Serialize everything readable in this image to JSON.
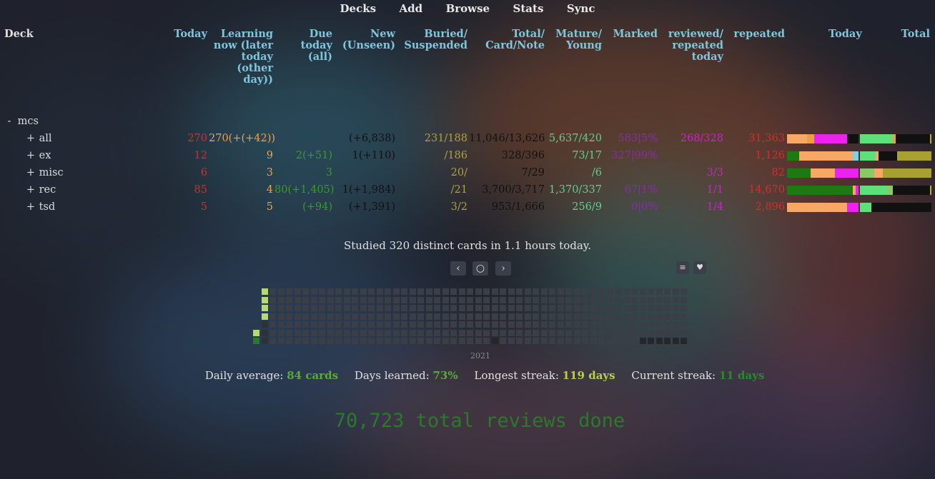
{
  "nav": [
    "Decks",
    "Add",
    "Browse",
    "Stats",
    "Sync"
  ],
  "columns": [
    {
      "key": "deck",
      "label": "Deck"
    },
    {
      "key": "today",
      "label": "Today"
    },
    {
      "key": "learning",
      "label": "Learning now (later today (other day))"
    },
    {
      "key": "due",
      "label": "Due today (all)"
    },
    {
      "key": "new",
      "label": "New (Unseen)"
    },
    {
      "key": "buried",
      "label": "Buried/ Suspended"
    },
    {
      "key": "total",
      "label": "Total/ Card/Note"
    },
    {
      "key": "mature",
      "label": "Mature/ Young"
    },
    {
      "key": "marked",
      "label": "Marked"
    },
    {
      "key": "reviewed",
      "label": "reviewed/ repeated today"
    },
    {
      "key": "repeated",
      "label": "repeated"
    },
    {
      "key": "bartoday",
      "label": "Today"
    },
    {
      "key": "bartotal",
      "label": "Total"
    }
  ],
  "decks": [
    {
      "name": "mcs",
      "expander": "-",
      "level": 0,
      "today": "",
      "learning": "",
      "due": "",
      "new": "",
      "buried": "",
      "total": "",
      "mature": "",
      "marked": "",
      "reviewed": "",
      "repeated": "",
      "bartoday": [],
      "bartotal": []
    },
    {
      "name": "all",
      "expander": "+",
      "level": 1,
      "today": "270",
      "learning": "270(+(+42))",
      "due": "",
      "new": "(+6,838)",
      "buried": "231/188",
      "total": "11,046/13,626",
      "mature": "5,637/420",
      "marked": "583|5%",
      "reviewed": "268/328",
      "repeated": "31,363",
      "bartoday": [
        {
          "c": "#f7a866",
          "w": 28
        },
        {
          "c": "#e8a040",
          "w": 10
        },
        {
          "c": "#ee22ee",
          "w": 46
        },
        {
          "c": "#111",
          "w": 16
        }
      ],
      "bartotal": [
        {
          "c": "#5de07a",
          "w": 46
        },
        {
          "c": "#e8a040",
          "w": 4
        },
        {
          "c": "#111",
          "w": 48
        },
        {
          "c": "#b8b030",
          "w": 2
        }
      ]
    },
    {
      "name": "ex",
      "expander": "+",
      "level": 1,
      "today": "12",
      "learning": "9",
      "due": "2(+51)",
      "new": "1(+110)",
      "buried": "/186",
      "total": "328/396",
      "mature": "73/17",
      "marked": "327|99%",
      "reviewed": "",
      "repeated": "1,126",
      "bartoday": [
        {
          "c": "#1d7a12",
          "w": 17
        },
        {
          "c": "#f7a866",
          "w": 75
        },
        {
          "c": "#7fd0e0",
          "w": 8
        }
      ],
      "bartotal": [
        {
          "c": "#5de07a",
          "w": 22
        },
        {
          "c": "#f7a866",
          "w": 4
        },
        {
          "c": "#111",
          "w": 26
        },
        {
          "c": "#a8a030",
          "w": 48
        }
      ]
    },
    {
      "name": "misc",
      "expander": "+",
      "level": 1,
      "today": "6",
      "learning": "3",
      "due": "3",
      "new": "",
      "buried": "20/",
      "total": "7/29",
      "mature": "/6",
      "marked": "",
      "reviewed": "3/3",
      "repeated": "82",
      "bartoday": [
        {
          "c": "#1d7a12",
          "w": 33
        },
        {
          "c": "#f7a866",
          "w": 34
        },
        {
          "c": "#ee22ee",
          "w": 33
        }
      ],
      "bartotal": [
        {
          "c": "#8ac86a",
          "w": 20
        },
        {
          "c": "#f7a866",
          "w": 12
        },
        {
          "c": "#a8a030",
          "w": 68
        }
      ]
    },
    {
      "name": "rec",
      "expander": "+",
      "level": 1,
      "today": "85",
      "learning": "4",
      "due": "80(+1,405)",
      "new": "1(+1,984)",
      "buried": "/21",
      "total": "3,700/3,717",
      "mature": "1,370/337",
      "marked": "67|1%",
      "reviewed": "1/1",
      "repeated": "14,670",
      "bartoday": [
        {
          "c": "#1d7a12",
          "w": 92
        },
        {
          "c": "#f7a866",
          "w": 4
        },
        {
          "c": "#ee22ee",
          "w": 4
        }
      ],
      "bartotal": [
        {
          "c": "#5de07a",
          "w": 38
        },
        {
          "c": "#8ac86a",
          "w": 8
        },
        {
          "c": "#111",
          "w": 52
        },
        {
          "c": "#b8b030",
          "w": 2
        }
      ]
    },
    {
      "name": "tsd",
      "expander": "+",
      "level": 1,
      "today": "5",
      "learning": "5",
      "due": "(+94)",
      "new": "(+1,391)",
      "buried": "3/2",
      "total": "953/1,666",
      "mature": "256/9",
      "marked": "0|0%",
      "reviewed": "1/4",
      "repeated": "2,896",
      "bartoday": [
        {
          "c": "#f7a866",
          "w": 84
        },
        {
          "c": "#ee22ee",
          "w": 16
        }
      ],
      "bartotal": [
        {
          "c": "#5de07a",
          "w": 16
        },
        {
          "c": "#111",
          "w": 84
        }
      ]
    }
  ],
  "studied": "Studied 320 distinct cards in 1.1 hours today.",
  "heatmap_year": "2021",
  "stats": {
    "daily_avg_label": "Daily average:",
    "daily_avg": "84 cards",
    "days_learned_label": "Days learned:",
    "days_learned": "73%",
    "longest_label": "Longest streak:",
    "longest": "119 days",
    "current_label": "Current streak:",
    "current": "11 days"
  },
  "total_reviews": "70,723 total reviews done"
}
